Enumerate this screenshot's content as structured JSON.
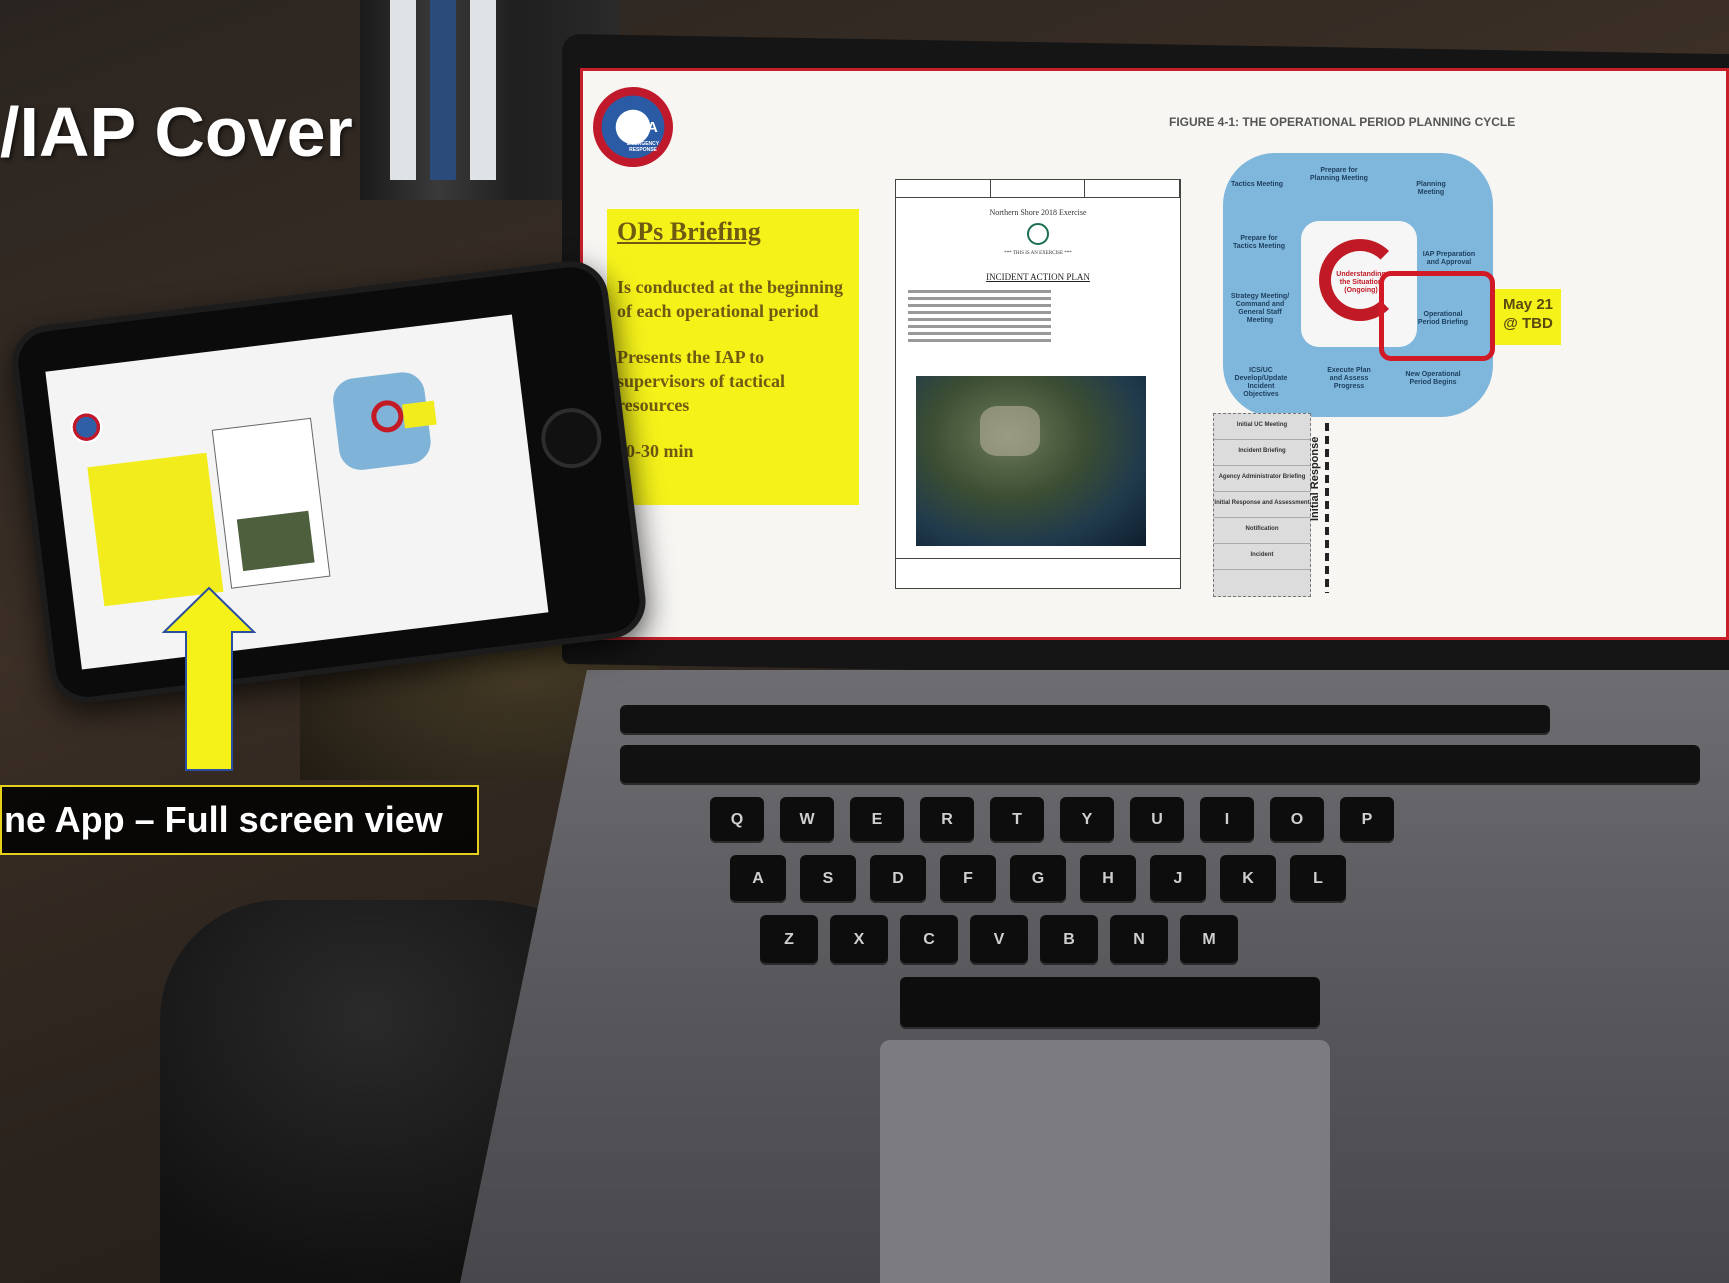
{
  "overlay": {
    "title": "/IAP Cover",
    "caption": "ne App – Full screen view"
  },
  "slide": {
    "logo_text": "EPA",
    "logo_sub": "EMERGENCY RESPONSE",
    "figure_title": "FIGURE 4-1: THE OPERATIONAL PERIOD PLANNING CYCLE",
    "briefing": {
      "heading": "OPs Briefing",
      "line1": "Is conducted at the beginning of each operational period",
      "line2": "Presents the IAP to supervisors of tactical resources",
      "line3": "20-30 min"
    },
    "document": {
      "exercise": "Northern Shore 2018 Exercise",
      "notice": "*** THIS IS AN EXERCISE ***",
      "heading": "INCIDENT ACTION PLAN"
    },
    "cycle": {
      "center": "Understanding the Situation (Ongoing)",
      "badge_line1": "May 21",
      "badge_line2": "@ TBD",
      "labels": [
        "Tactics Meeting",
        "Prepare for Planning Meeting",
        "Planning Meeting",
        "Prepare for Tactics Meeting",
        "IAP Preparation and Approval",
        "Strategy Meeting/ Command and General Staff Meeting",
        "Operational Period Briefing",
        "ICS/UC Develop/Update Incident Objectives",
        "Execute Plan and Assess Progress",
        "New Operational Period Begins"
      ],
      "stack": [
        "Initial UC Meeting",
        "Incident Briefing",
        "Agency Administrator Briefing",
        "Initial Response and Assessment",
        "Notification",
        "Incident"
      ],
      "initial_response": "Initial Response"
    }
  },
  "keyboard": {
    "row1": [
      "Q",
      "W",
      "E",
      "R",
      "T",
      "Y",
      "U",
      "I",
      "O",
      "P"
    ],
    "row2": [
      "A",
      "S",
      "D",
      "F",
      "G",
      "H",
      "J",
      "K",
      "L"
    ],
    "row3": [
      "Z",
      "X",
      "C",
      "V",
      "B",
      "N",
      "M"
    ]
  },
  "colors": {
    "accent_yellow": "#f5f21a",
    "epa_red": "#c0192b",
    "cycle_blue": "#7fb6db"
  }
}
